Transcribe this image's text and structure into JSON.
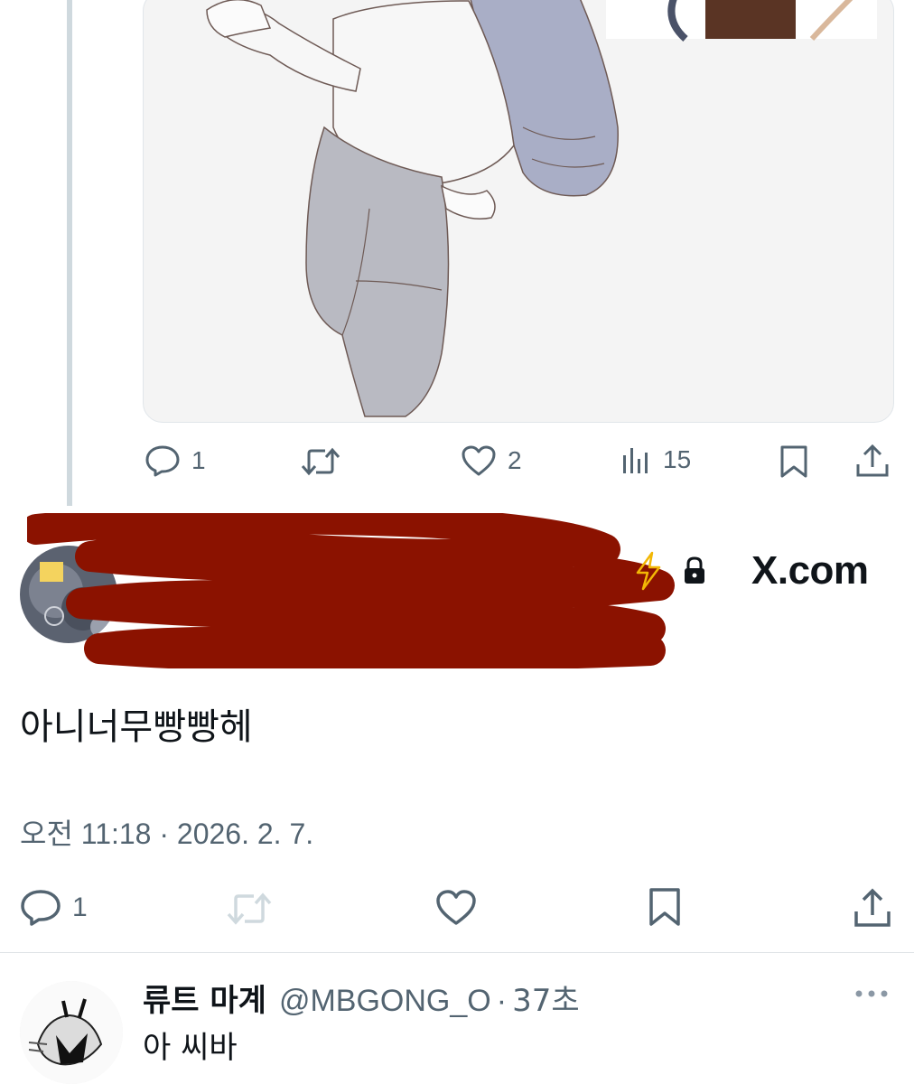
{
  "thread_tweet": {
    "actions": {
      "reply_count": "1",
      "retweet_count": "",
      "like_count": "2",
      "view_count": "15"
    }
  },
  "browser": {
    "url_host": "X.com",
    "icons": [
      "lightning-icon",
      "lock-icon"
    ]
  },
  "main_tweet": {
    "text": "아니너무빵빵헤",
    "timestamp": "오전 11:18 · 2026. 2. 7.",
    "actions": {
      "reply_count": "1"
    }
  },
  "reply": {
    "display_name": "류트 마계",
    "handle": "@MBGONG_O",
    "separator": "·",
    "time_ago": "37초",
    "text": "아 씨바"
  },
  "colors": {
    "text_primary": "#0f1419",
    "text_secondary": "#536471",
    "redaction": "#8b1200",
    "lightning": "#f2b705"
  }
}
